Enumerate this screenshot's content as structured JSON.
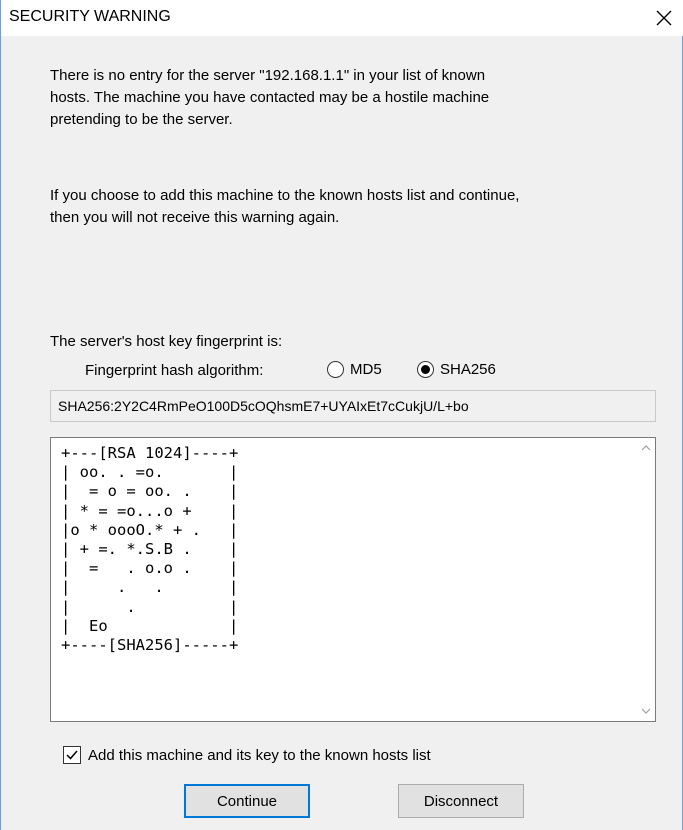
{
  "window": {
    "title": "SECURITY WARNING",
    "close_label": "Close"
  },
  "message": {
    "paragraph1_line1": "There is no entry for the server \"192.168.1.1\" in your list of known",
    "paragraph1_line2": "hosts. The machine you have contacted may be a hostile machine",
    "paragraph1_line3": "pretending to be the server.",
    "paragraph2_line1": "If you choose to add this machine to the known hosts list and continue,",
    "paragraph2_line2": "then you will not receive this warning again."
  },
  "fingerprint": {
    "heading": "The server's host key fingerprint is:",
    "algorithm_label": "Fingerprint hash algorithm:",
    "options": [
      {
        "label": "MD5",
        "selected": false
      },
      {
        "label": "SHA256",
        "selected": true
      }
    ],
    "value": "SHA256:2Y2C4RmPeO100D5cOQhsmE7+UYAIxEt7cCukjU/L+bo"
  },
  "randomart": {
    "text": "+---[RSA 1024]----+\n| oo. . =o.       |\n|  = o = oo. .    |\n| * = =o...o +    |\n|o * oooO.* + .   |\n| + =. *.S.B .    |\n|  =   . o.o .    |\n|     .   .       |\n|      .          |\n|  Eo             |\n+----[SHA256]-----+"
  },
  "options": {
    "add_to_known_hosts_label": "Add this machine and its key to the known hosts list",
    "add_to_known_hosts_checked": true
  },
  "buttons": {
    "continue_label": "Continue",
    "disconnect_label": "Disconnect"
  }
}
